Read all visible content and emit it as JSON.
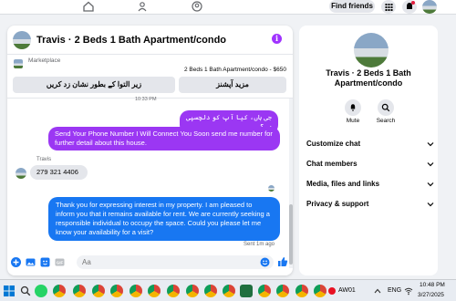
{
  "topbar": {
    "find_friends": "Find friends"
  },
  "chat": {
    "title": "Travis · 2 Beds 1 Bath Apartment/condo",
    "info_icon": "i",
    "marketplace_label": "Marketplace",
    "listing": "2 Beds 1 Bath Apartment/condo - $650",
    "btn_left": "زیر التوا کے بطور نشان زد کریں",
    "btn_right": "مزید آپشنز",
    "time_divider": "10:33 PM",
    "messages": [
      {
        "text": "جی ہاں، کیا آپ کو دلچسپی ہے؟"
      },
      {
        "text": "Send Your Phone Number I Will Connect You Soon  send me number for further detail about this house."
      },
      {
        "sender": "Travis",
        "text": "279 321 4406"
      },
      {
        "text": "Thank you for expressing interest in my property. I am pleased to inform you that it remains available for rent. We are currently seeking a responsible individual to occupy the space. Could you please let me know your availability for a visit?"
      }
    ],
    "sent_status": "Sent 1m ago",
    "input_placeholder": "Aa"
  },
  "right_panel": {
    "title": "Travis · 2 Beds 1 Bath Apartment/condo",
    "mute_label": "Mute",
    "search_label": "Search",
    "rows": [
      "Customize chat",
      "Chat members",
      "Media, files and links",
      "Privacy & support"
    ]
  },
  "taskbar": {
    "weather": "AW01",
    "lang": "ENG",
    "time": "10:48 PM",
    "date": "3/27/2025"
  },
  "colors": {
    "accent_purple": "#9b37f3",
    "accent_blue": "#1877f2"
  }
}
